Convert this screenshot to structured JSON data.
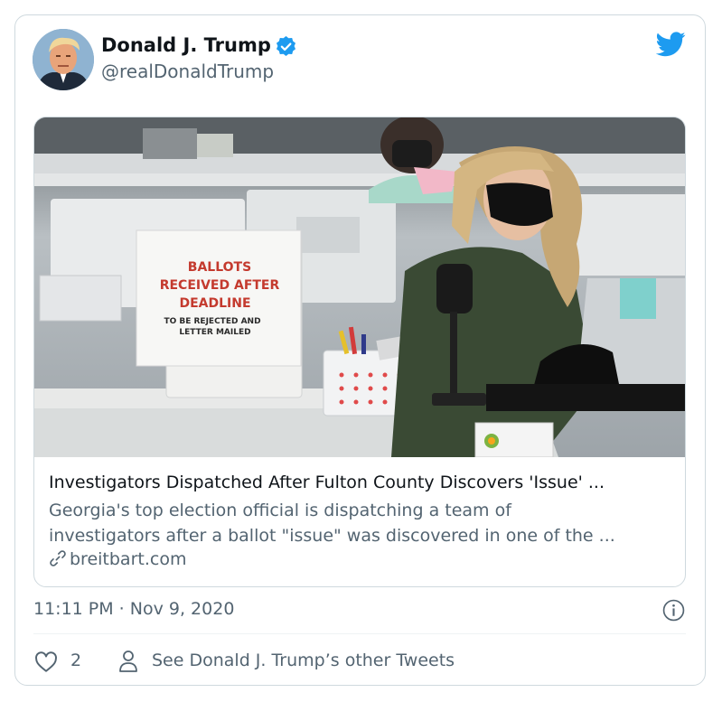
{
  "author": {
    "name": "Donald J. Trump",
    "handle": "@realDonaldTrump",
    "verified": true,
    "avatar_icon": "avatar-portrait"
  },
  "brand_icon": "twitter-bird-icon",
  "colors": {
    "accent": "#1d9bf0",
    "text_primary": "#0f1419",
    "text_secondary": "#536471",
    "border": "#cfd9de"
  },
  "card": {
    "image_sign": {
      "line1": "BALLOTS",
      "line2": "RECEIVED AFTER",
      "line3": "DEADLINE",
      "line4": "TO BE REJECTED AND",
      "line5": "LETTER MAILED"
    },
    "title": "Investigators Dispatched After Fulton County Discovers 'Issue' ...",
    "description_line1": "Georgia's top election official is dispatching a team of",
    "description_line2": "investigators after a ballot \"issue\" was discovered in one of the ...",
    "domain": "breitbart.com"
  },
  "timestamp": "11:11 PM · Nov 9, 2020",
  "actions": {
    "like_count": "2",
    "see_other_tweets": "See Donald J. Trump’s other Tweets"
  }
}
